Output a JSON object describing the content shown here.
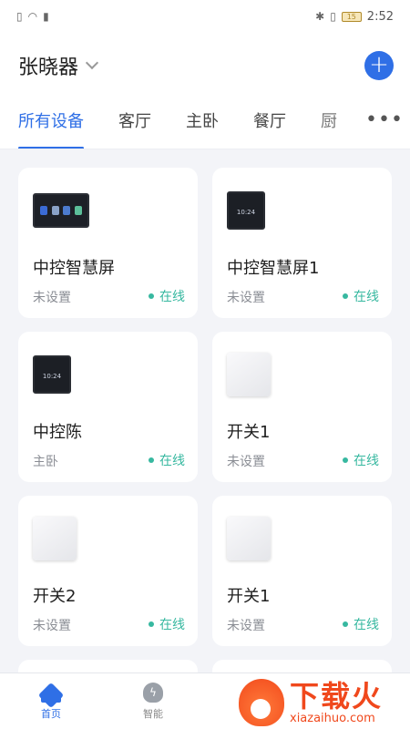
{
  "status_bar": {
    "time": "2:52",
    "battery": "15"
  },
  "header": {
    "home_name": "张晓器",
    "add_label": "+"
  },
  "tabs": [
    "所有设备",
    "客厅",
    "主卧",
    "餐厅",
    "厨"
  ],
  "more_label": "•••",
  "devices": [
    {
      "name": "中控智慧屏",
      "room": "未设置",
      "status": "在线",
      "thumb": "panel-wide"
    },
    {
      "name": "中控智慧屏1",
      "room": "未设置",
      "status": "在线",
      "thumb": "panel-square",
      "screen_text": "10:24"
    },
    {
      "name": "中控陈",
      "room": "主卧",
      "status": "在线",
      "thumb": "panel-square",
      "screen_text": "10:24"
    },
    {
      "name": "开关1",
      "room": "未设置",
      "status": "在线",
      "thumb": "panel-switch"
    },
    {
      "name": "开关2",
      "room": "未设置",
      "status": "在线",
      "thumb": "panel-switch"
    },
    {
      "name": "开关1",
      "room": "未设置",
      "status": "在线",
      "thumb": "panel-switch"
    }
  ],
  "bottom_nav": [
    {
      "label": "首页",
      "icon": "home-icon"
    },
    {
      "label": "智能",
      "icon": "bulb-icon"
    }
  ],
  "watermark": {
    "cn": "下载火",
    "en": "xiazaihuo.com"
  },
  "colors": {
    "accent": "#2f6fe6",
    "online": "#37b8a0",
    "watermark": "#f0481c"
  }
}
